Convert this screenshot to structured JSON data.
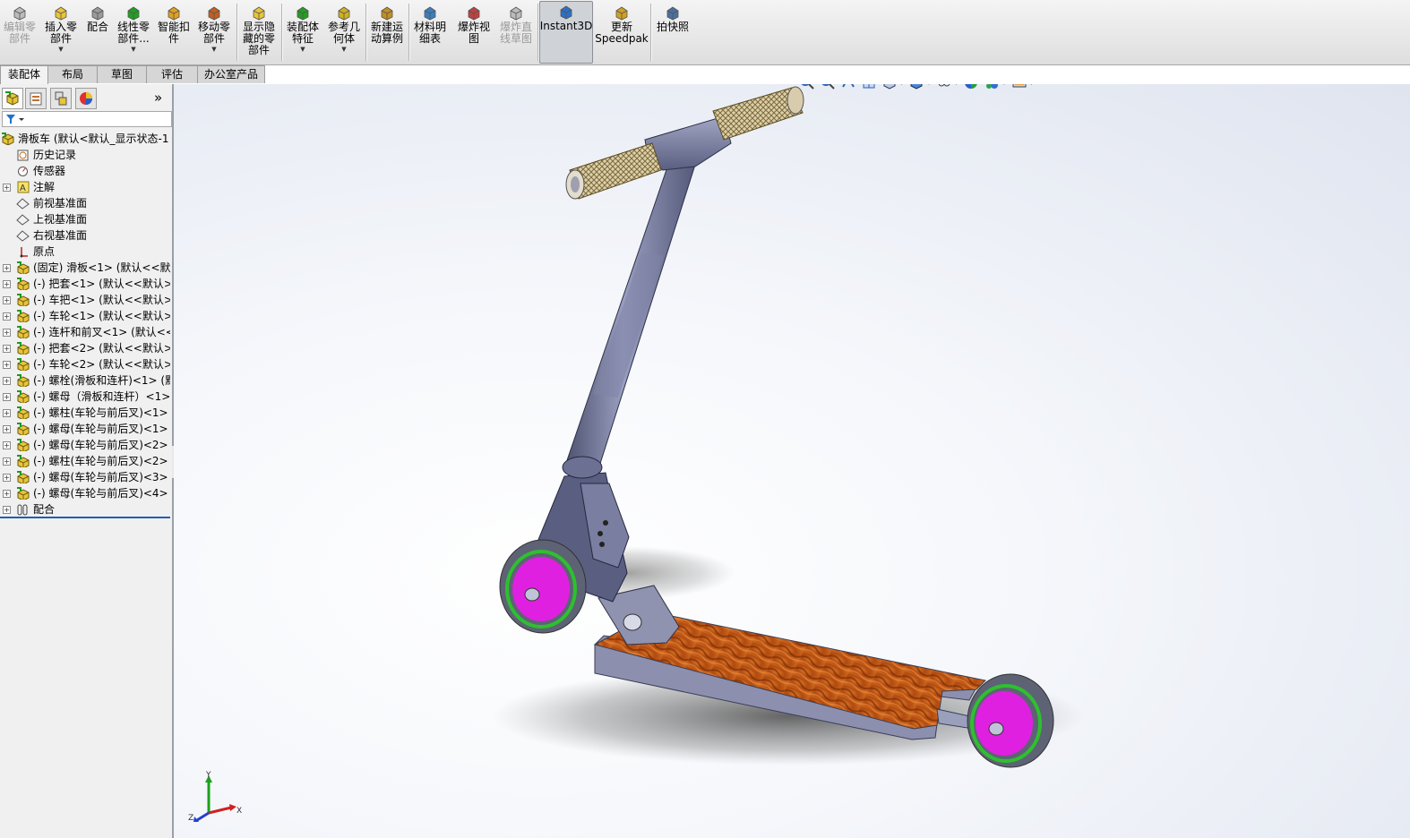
{
  "toolbar": {
    "buttons": [
      {
        "id": "edit-part",
        "label": "编辑零\n部件",
        "disabled": true,
        "dropdown": false,
        "icon": "edit-component-icon"
      },
      {
        "id": "insert-part",
        "label": "插入零\n部件",
        "disabled": false,
        "dropdown": true,
        "icon": "insert-component-icon"
      },
      {
        "id": "mate",
        "label": "配合",
        "disabled": false,
        "dropdown": false,
        "icon": "mate-icon"
      },
      {
        "id": "linear-pattern",
        "label": "线性零\n部件...",
        "disabled": false,
        "dropdown": true,
        "icon": "linear-pattern-icon"
      },
      {
        "id": "smart-fastener",
        "label": "智能扣\n件",
        "disabled": false,
        "dropdown": false,
        "icon": "smart-fastener-icon"
      },
      {
        "id": "move-part",
        "label": "移动零\n部件",
        "disabled": false,
        "dropdown": true,
        "icon": "move-component-icon"
      },
      {
        "id": "show-hidden",
        "label": "显示隐\n藏的零\n部件",
        "disabled": false,
        "dropdown": false,
        "icon": "show-hidden-icon"
      },
      {
        "id": "assembly-feature",
        "label": "装配体\n特征",
        "disabled": false,
        "dropdown": true,
        "icon": "assembly-feature-icon"
      },
      {
        "id": "ref-geometry",
        "label": "参考几\n何体",
        "disabled": false,
        "dropdown": true,
        "icon": "reference-geometry-icon"
      },
      {
        "id": "new-motion",
        "label": "新建运\n动算例",
        "disabled": false,
        "dropdown": false,
        "icon": "motion-study-icon"
      },
      {
        "id": "bom",
        "label": "材料明\n细表",
        "disabled": false,
        "dropdown": false,
        "icon": "bill-of-materials-icon"
      },
      {
        "id": "explode",
        "label": "爆炸视\n图",
        "disabled": false,
        "dropdown": false,
        "icon": "explode-view-icon"
      },
      {
        "id": "explode-line",
        "label": "爆炸直\n线草图",
        "disabled": true,
        "dropdown": false,
        "icon": "explode-line-icon"
      },
      {
        "id": "instant3d",
        "label": "Instant3D",
        "disabled": false,
        "dropdown": false,
        "active": true,
        "icon": "instant3d-icon"
      },
      {
        "id": "speedpak",
        "label": "更新\nSpeedpak",
        "disabled": false,
        "dropdown": false,
        "icon": "speedpak-icon"
      },
      {
        "id": "snapshot",
        "label": "拍快照",
        "disabled": false,
        "dropdown": false,
        "icon": "snapshot-icon"
      }
    ]
  },
  "tabs": [
    {
      "label": "装配体",
      "active": true
    },
    {
      "label": "布局",
      "active": false
    },
    {
      "label": "草图",
      "active": false
    },
    {
      "label": "评估",
      "active": false
    },
    {
      "label": "办公室产品",
      "active": false
    }
  ],
  "panel": {
    "expand_symbol": "»",
    "tree": [
      {
        "label": "滑板车  (默认<默认_显示状态-1",
        "indent": 0,
        "expander": false,
        "icon": "assembly-icon"
      },
      {
        "label": "历史记录",
        "indent": 1,
        "expander": false,
        "icon": "history-icon"
      },
      {
        "label": "传感器",
        "indent": 1,
        "expander": false,
        "icon": "sensor-icon"
      },
      {
        "label": "注解",
        "indent": 1,
        "expander": true,
        "icon": "annotation-icon"
      },
      {
        "label": "前视基准面",
        "indent": 1,
        "expander": false,
        "icon": "plane-icon"
      },
      {
        "label": "上视基准面",
        "indent": 1,
        "expander": false,
        "icon": "plane-icon"
      },
      {
        "label": "右视基准面",
        "indent": 1,
        "expander": false,
        "icon": "plane-icon"
      },
      {
        "label": "原点",
        "indent": 1,
        "expander": false,
        "icon": "origin-icon"
      },
      {
        "label": "(固定) 滑板<1> (默认<<默认",
        "indent": 1,
        "expander": true,
        "icon": "part-icon"
      },
      {
        "label": "(-) 把套<1> (默认<<默认>_",
        "indent": 1,
        "expander": true,
        "icon": "part-icon"
      },
      {
        "label": "(-) 车把<1> (默认<<默认>_",
        "indent": 1,
        "expander": true,
        "icon": "part-icon"
      },
      {
        "label": "(-) 车轮<1> (默认<<默认>_",
        "indent": 1,
        "expander": true,
        "icon": "part-icon"
      },
      {
        "label": "(-) 连杆和前叉<1> (默认<<",
        "indent": 1,
        "expander": true,
        "icon": "part-icon"
      },
      {
        "label": "(-) 把套<2> (默认<<默认>_",
        "indent": 1,
        "expander": true,
        "icon": "part-icon"
      },
      {
        "label": "(-) 车轮<2> (默认<<默认>_",
        "indent": 1,
        "expander": true,
        "icon": "part-icon"
      },
      {
        "label": "(-) 螺栓(滑板和连杆)<1> (默认",
        "indent": 1,
        "expander": true,
        "icon": "part-icon"
      },
      {
        "label": "(-) 螺母（滑板和连杆）<1>",
        "indent": 1,
        "expander": true,
        "icon": "part-icon"
      },
      {
        "label": "(-) 螺柱(车轮与前后叉)<1> (",
        "indent": 1,
        "expander": true,
        "icon": "part-icon"
      },
      {
        "label": "(-) 螺母(车轮与前后叉)<1> (",
        "indent": 1,
        "expander": true,
        "icon": "part-icon"
      },
      {
        "label": "(-) 螺母(车轮与前后叉)<2> (",
        "indent": 1,
        "expander": true,
        "icon": "part-icon"
      },
      {
        "label": "(-) 螺柱(车轮与前后叉)<2> (",
        "indent": 1,
        "expander": true,
        "icon": "part-icon"
      },
      {
        "label": "(-) 螺母(车轮与前后叉)<3> (",
        "indent": 1,
        "expander": true,
        "icon": "part-icon"
      },
      {
        "label": "(-) 螺母(车轮与前后叉)<4> (",
        "indent": 1,
        "expander": true,
        "icon": "part-icon"
      },
      {
        "label": "配合",
        "indent": 1,
        "expander": true,
        "icon": "mates-icon"
      }
    ]
  },
  "triad": {
    "x": "X",
    "y": "Y",
    "z": "Z"
  },
  "colors": {
    "deck": "#c8601a",
    "wheel_hub": "#e020e0",
    "wheel_ring": "#2ec02e",
    "frame": "#6d7290",
    "grip": "#c9b48a"
  }
}
